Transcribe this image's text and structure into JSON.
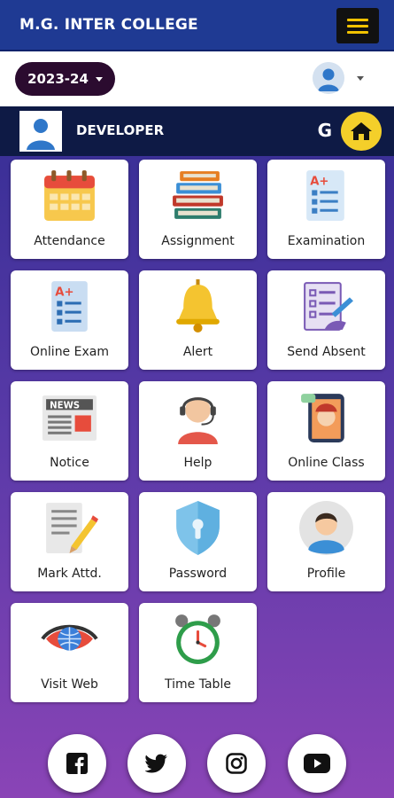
{
  "header": {
    "title": "M.G. INTER COLLEGE",
    "menu_icon": "hamburger-icon"
  },
  "session": {
    "year": "2023-24",
    "user_icon": "user-avatar-icon"
  },
  "profile_bar": {
    "name": "DEVELOPER",
    "letter": "G",
    "home_icon": "home-icon"
  },
  "menu": {
    "items": [
      {
        "label": "Attendance",
        "icon": "calendar-icon"
      },
      {
        "label": "Assignment",
        "icon": "books-icon"
      },
      {
        "label": "Examination",
        "icon": "exam-sheet-icon"
      },
      {
        "label": "Online Exam",
        "icon": "online-exam-icon"
      },
      {
        "label": "Alert",
        "icon": "bell-icon"
      },
      {
        "label": "Send Absent",
        "icon": "absent-form-icon"
      },
      {
        "label": "Notice",
        "icon": "newspaper-icon"
      },
      {
        "label": "Help",
        "icon": "support-agent-icon"
      },
      {
        "label": "Online Class",
        "icon": "video-class-icon"
      },
      {
        "label": "Mark Attd.",
        "icon": "mark-pencil-icon"
      },
      {
        "label": "Password",
        "icon": "shield-lock-icon"
      },
      {
        "label": "Profile",
        "icon": "profile-icon"
      },
      {
        "label": "Visit Web",
        "icon": "web-eye-icon"
      },
      {
        "label": "Time Table",
        "icon": "alarm-clock-icon"
      }
    ]
  },
  "social": [
    "facebook-icon",
    "twitter-icon",
    "instagram-icon",
    "youtube-icon"
  ],
  "colors": {
    "header": "#1f3a93",
    "accent": "#f4cf2a",
    "pill": "#2b0b2f",
    "dev_bar": "#0e1a45"
  }
}
